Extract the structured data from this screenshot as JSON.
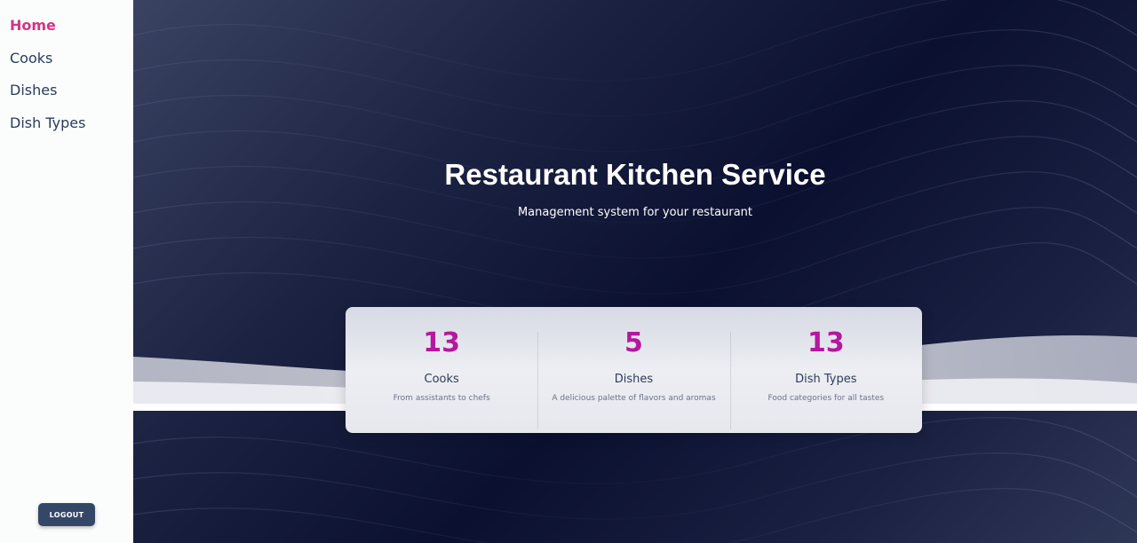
{
  "sidebar": {
    "items": [
      {
        "label": "Home",
        "active": true
      },
      {
        "label": "Cooks",
        "active": false
      },
      {
        "label": "Dishes",
        "active": false
      },
      {
        "label": "Dish Types",
        "active": false
      }
    ],
    "logout_label": "LOGOUT"
  },
  "hero": {
    "title": "Restaurant Kitchen Service",
    "subtitle": "Management system for your restaurant"
  },
  "stats": [
    {
      "value": "13",
      "label": "Cooks",
      "description": "From assistants to chefs"
    },
    {
      "value": "5",
      "label": "Dishes",
      "description": "A delicious palette of flavors and aromas"
    },
    {
      "value": "13",
      "label": "Dish Types",
      "description": "Food categories for all tastes"
    }
  ],
  "colors": {
    "active_nav": "#d63384",
    "nav_text": "#2c3b5c",
    "stat_value": "#b5179e",
    "logout_bg": "#344767",
    "hero_dark": "#0b1030"
  }
}
